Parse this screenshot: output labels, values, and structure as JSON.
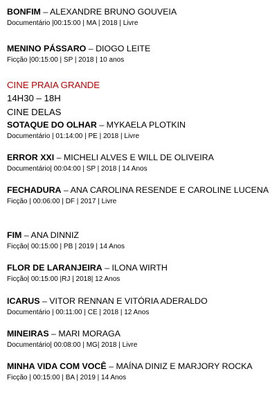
{
  "entries_top": [
    {
      "title": "BONFIM",
      "sep": " – ",
      "director": "ALEXANDRE BRUNO GOUVEIA",
      "meta": "Documentário |00:15:00 | MA | 2018 | Livre"
    },
    {
      "title": "MENINO PÁSSARO",
      "sep": " – ",
      "director": "DIOGO LEITE",
      "meta": "Ficção |00:15:00 | SP | 2018 | 10 anos"
    }
  ],
  "venue": {
    "name": "CINE PRAIA GRANDE",
    "name_color": "#c00000",
    "time": "14H30 – 18H",
    "session": "CINE DELAS"
  },
  "entries": [
    {
      "title": "SOTAQUE DO OLHAR",
      "sep": " – ",
      "director": "MYKAELA PLOTKIN",
      "meta": "Documentário | 01:14:00 | PE | 2018 | Livre"
    },
    {
      "title": "ERROR XXI",
      "sep": " – ",
      "director": "MICHELI ALVES E WILL DE OLIVEIRA",
      "meta": "Documentário| 00:04:00 | SP | 2018 | 14 Anos"
    },
    {
      "title": "FECHADURA",
      "sep": " – ",
      "director": "ANA CAROLINA RESENDE E CAROLINE LUCENA",
      "meta": "Ficção | 00:06:00 | DF | 2017 | Livre"
    },
    {
      "title": "FIM",
      "sep": " – ",
      "director": "ANA DINNIZ",
      "meta": "Ficção| 00:15:00 | PB | 2019 | 14 Anos"
    },
    {
      "title": "FLOR DE LARANJEIRA",
      "sep": " – ",
      "director": "ILONA WIRTH",
      "meta": "Ficção| 00:15:00 |RJ | 2018| 12 Anos"
    },
    {
      "title": "ICARUS",
      "sep": " – ",
      "director": "VITOR RENNAN E VITÓRIA ADERALDO",
      "meta": "Documentário | 00:11:00 | CE | 2018 | 12 Anos"
    },
    {
      "title": "MINEIRAS",
      "sep": " – ",
      "director": "MARI MORAGA",
      "meta": "Documentário| 00:08:00 | MG| 2018 | Livre"
    },
    {
      "title": "MINHA VIDA COM VOCÊ",
      "sep": " – ",
      "director": "MAÍNA DINIZ E MARJORY ROCKA",
      "meta": "Ficção | 00:15:00 | BA | 2019 | 14 Anos"
    }
  ]
}
